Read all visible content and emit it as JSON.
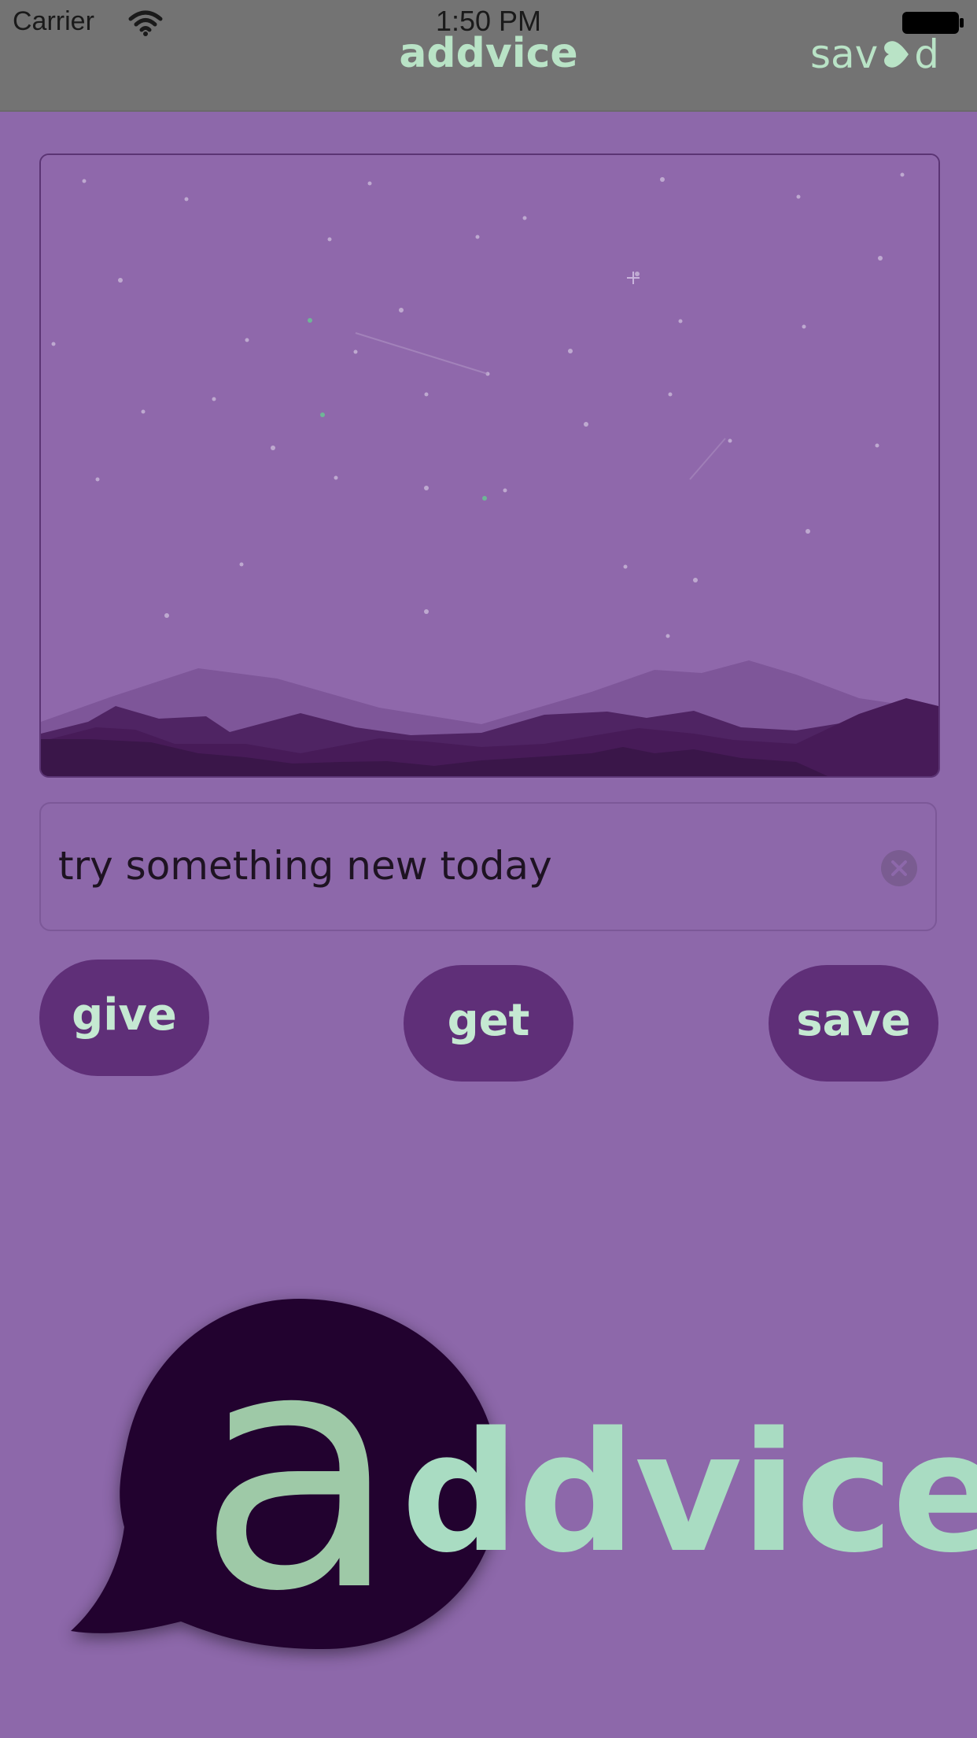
{
  "status_bar": {
    "carrier": "Carrier",
    "time": "1:50 PM"
  },
  "nav": {
    "title": "addvice",
    "saved_prefix": "sav",
    "saved_suffix": "d"
  },
  "advice_field": {
    "value": "try something new today"
  },
  "buttons": {
    "give": "give",
    "get": "get",
    "save": "save"
  },
  "logo": {
    "big_letter": "a",
    "rest": "ddvice"
  },
  "colors": {
    "background": "#8d68aa",
    "navbar": "#737373",
    "accent_green": "#b9e3c6",
    "button_purple": "#5f2f78",
    "logo_bubble": "#22022f"
  },
  "icons": [
    "wifi-icon",
    "battery-icon",
    "heart-icon",
    "clear-icon"
  ]
}
